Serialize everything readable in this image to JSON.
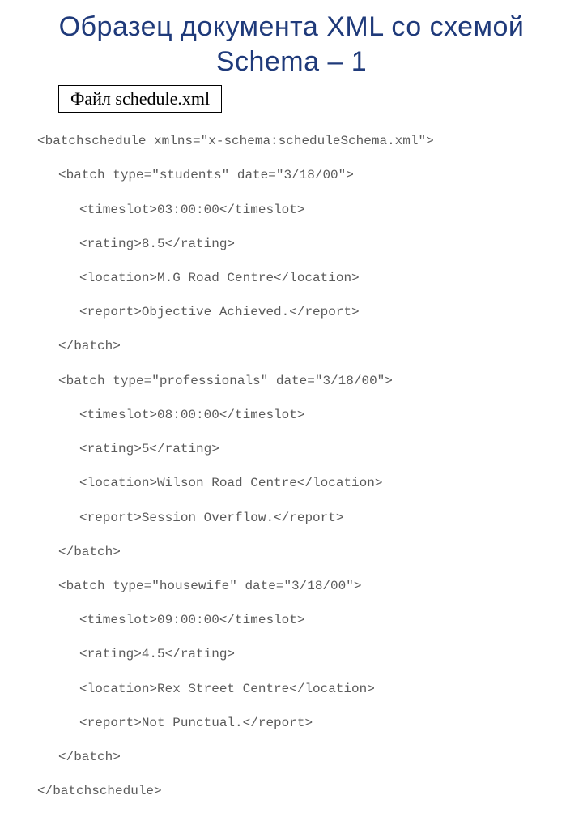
{
  "title": "Образец документа XML со схемой Schema – 1",
  "file_label": "Файл schedule.xml",
  "code": {
    "l01": "<batchschedule xmlns=\"x-schema:scheduleSchema.xml\">",
    "l02": "<batch type=\"students\" date=\"3/18/00\">",
    "l03": "<timeslot>03:00:00</timeslot>",
    "l04": "<rating>8.5</rating>",
    "l05": "<location>M.G Road Centre</location>",
    "l06": "<report>Objective Achieved.</report>",
    "l07": "</batch>",
    "l08": "<batch type=\"professionals\" date=\"3/18/00\">",
    "l09": "<timeslot>08:00:00</timeslot>",
    "l10": "<rating>5</rating>",
    "l11": "<location>Wilson Road Centre</location>",
    "l12": "<report>Session Overflow.</report>",
    "l13": "</batch>",
    "l14": "<batch type=\"housewife\" date=\"3/18/00\">",
    "l15": "<timeslot>09:00:00</timeslot>",
    "l16": "<rating>4.5</rating>",
    "l17": "<location>Rex Street Centre</location>",
    "l18": "<report>Not Punctual.</report>",
    "l19": "</batch>",
    "l20": "</batchschedule>"
  }
}
